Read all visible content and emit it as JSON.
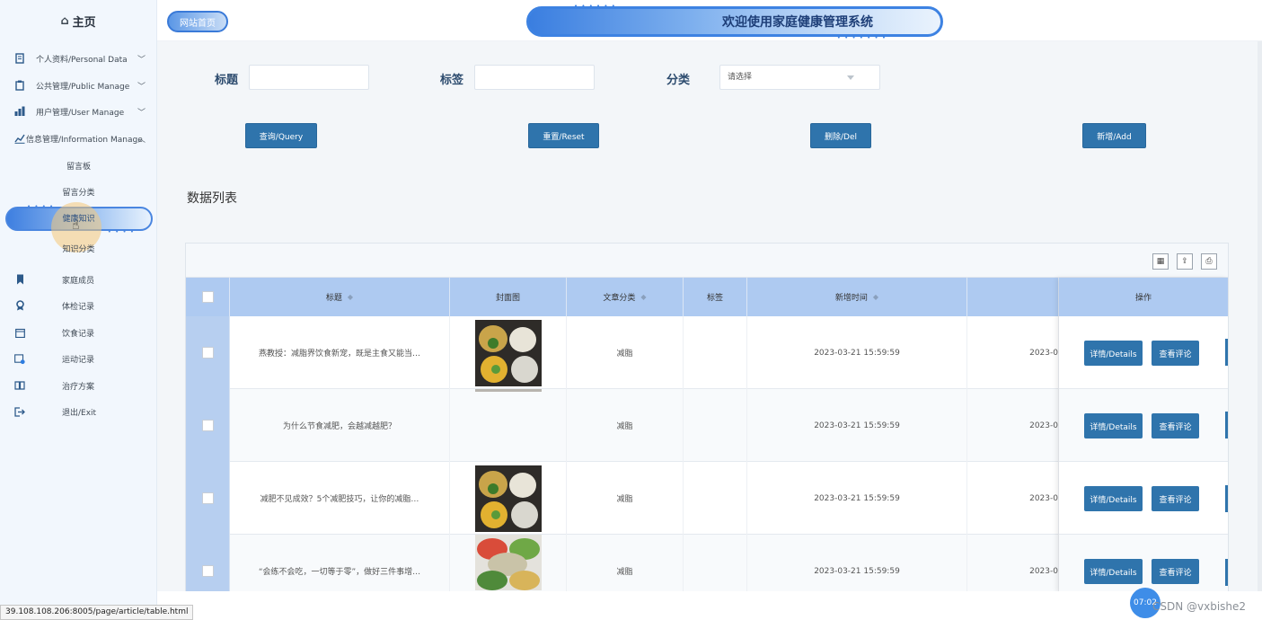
{
  "sidebar": {
    "home": "主页",
    "menus": [
      {
        "label": "个人资料/Personal Data",
        "icon": "document-icon"
      },
      {
        "label": "公共管理/Public Manage",
        "icon": "clipboard-icon"
      },
      {
        "label": "用户管理/User Manage",
        "icon": "users-icon"
      },
      {
        "label": "信息管理/Information Manage",
        "icon": "chart-icon"
      }
    ],
    "submenus": [
      "留言板",
      "留言分类",
      "健康知识",
      "知识分类"
    ],
    "active_submenu": "健康知识",
    "links": [
      {
        "label": "家庭成员",
        "icon": "bookmark-icon"
      },
      {
        "label": "体检记录",
        "icon": "award-icon"
      },
      {
        "label": "饮食记录",
        "icon": "calendar-icon"
      },
      {
        "label": "运动记录",
        "icon": "calendar-check-icon"
      },
      {
        "label": "治疗方案",
        "icon": "book-icon"
      },
      {
        "label": "退出/Exit",
        "icon": "logout-icon"
      }
    ]
  },
  "header": {
    "site_home": "网站首页",
    "banner_title": "欢迎使用家庭健康管理系统"
  },
  "filters": {
    "title_label": "标题",
    "tag_label": "标签",
    "category_label": "分类",
    "title_value": "",
    "tag_value": "",
    "category_placeholder": "请选择"
  },
  "actions": {
    "query": "查询/Query",
    "reset": "重置/Reset",
    "delete": "删除/Del",
    "add": "新增/Add"
  },
  "list_title": "数据列表",
  "table": {
    "columns": [
      "标题",
      "封面图",
      "文章分类",
      "标签",
      "新增时间"
    ],
    "op_column": "操作",
    "rows": [
      {
        "title": "燕教授：减脂界饮食新宠，既是主食又能当…",
        "category": "减脂",
        "tag": "",
        "time": "2023-03-21 15:59:59",
        "extra": "2023-0",
        "cover": "salad-bowls"
      },
      {
        "title": "为什么节食减肥，会越减越肥？",
        "category": "减脂",
        "tag": "",
        "time": "2023-03-21 15:59:59",
        "extra": "2023-0",
        "cover": "none"
      },
      {
        "title": "减肥不见成效？5个减肥技巧，让你的减脂…",
        "category": "减脂",
        "tag": "",
        "time": "2023-03-21 15:59:59",
        "extra": "2023-0",
        "cover": "salad-bowls"
      },
      {
        "title": "“会练不会吃，一切等于零”，做好三件事增…",
        "category": "减脂",
        "tag": "",
        "time": "2023-03-21 15:59:59",
        "extra": "2023-0",
        "cover": "vegetable-bowls"
      }
    ],
    "details_btn": "详情/Details",
    "comments_btn": "查看评论"
  },
  "status_url": "39.108.108.206:8005/page/article/table.html",
  "clock": "07:02",
  "watermark": "CSDN @vxbishe2",
  "colors": {
    "primary": "#2f74ac",
    "header_blue": "#aecaf1",
    "sidebar_bg": "#f2f7fd"
  }
}
